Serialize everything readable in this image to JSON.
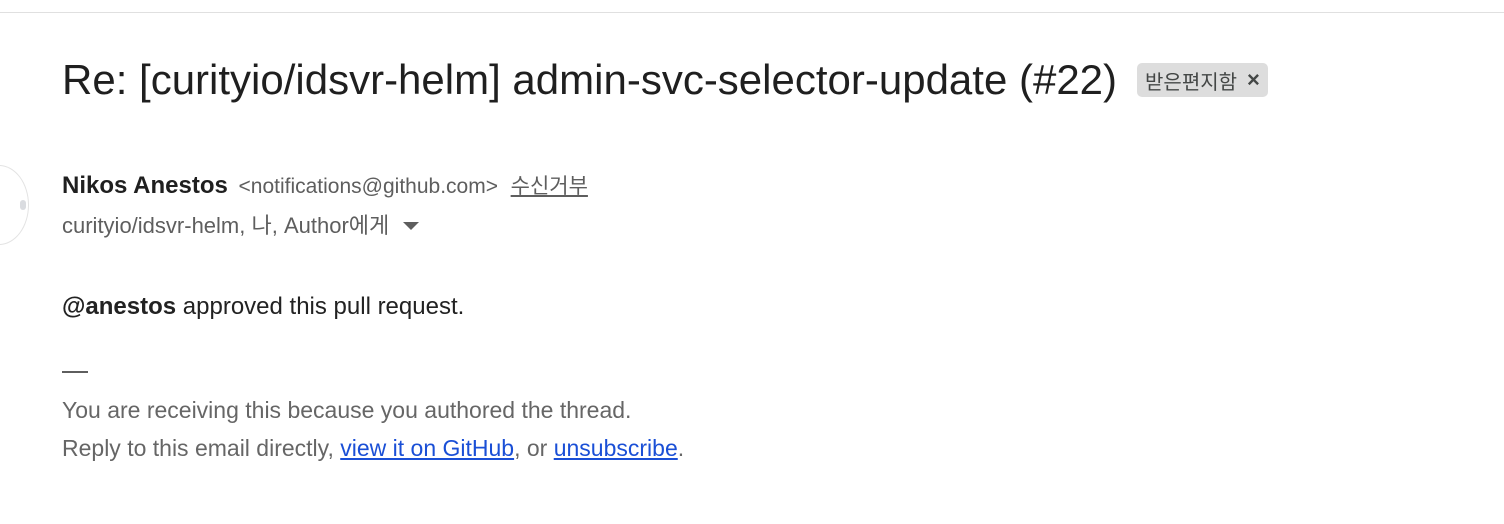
{
  "email": {
    "subject": "Re: [curityio/idsvr-helm] admin-svc-selector-update (#22)",
    "label": {
      "text": "받은편지함",
      "remove_glyph": "×"
    },
    "sender": {
      "name": "Nikos Anestos",
      "email": "<notifications@github.com>",
      "unsubscribe_label": "수신거부"
    },
    "recipients": "curityio/idsvr-helm, 나, Author에게",
    "body": {
      "mention": "@anestos",
      "message": " approved this pull request.",
      "signature_dash": "—"
    },
    "footer": {
      "line1": "You are receiving this because you authored the thread.",
      "line2_prefix": "Reply to this email directly, ",
      "view_link": "view it on GitHub",
      "middle": ", or ",
      "unsubscribe_link": "unsubscribe",
      "suffix": "."
    }
  },
  "colors": {
    "link": "#1a4fd6",
    "chip_background": "#dddddd",
    "muted_text": "#5e5e5e"
  },
  "icons": {
    "label_remove": "close-icon",
    "recipients_toggle": "chevron-down-icon"
  }
}
